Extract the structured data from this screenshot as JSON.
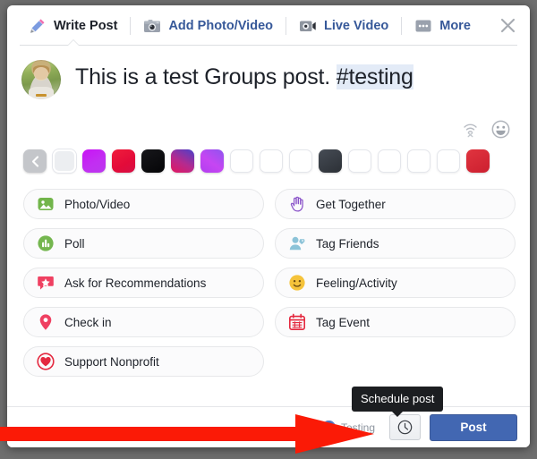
{
  "dialog": {
    "close_label": "close-icon"
  },
  "tabs": [
    {
      "label": "Write Post",
      "icon": "pencil-icon",
      "active": true
    },
    {
      "label": "Add Photo/Video",
      "icon": "camera-icon",
      "active": false
    },
    {
      "label": "Live Video",
      "icon": "video-camera-icon",
      "active": false
    },
    {
      "label": "More",
      "icon": "ellipsis-icon",
      "active": false
    }
  ],
  "composer": {
    "text_before": "This is a test Groups post. ",
    "hashtag": "#testing",
    "avatar_alt": "user-avatar"
  },
  "toolrow": [
    {
      "name": "gif-off-icon"
    },
    {
      "name": "emoji-icon"
    }
  ],
  "palette": {
    "prev_label": "chevron-left-icon",
    "swatches": [
      {
        "name": "swatch-white",
        "color": "#eceef1"
      },
      {
        "name": "swatch-magenta",
        "color": "#cf22f0"
      },
      {
        "name": "swatch-red",
        "color": "#e5173f"
      },
      {
        "name": "swatch-black",
        "color": "#0b0b0d"
      },
      {
        "name": "swatch-pink-blue",
        "color": "#c62368"
      },
      {
        "name": "swatch-purple",
        "color": "#b93df0"
      },
      {
        "name": "swatch-blank-1",
        "color": "#ffffff"
      },
      {
        "name": "swatch-blank-2",
        "color": "#ffffff"
      },
      {
        "name": "swatch-blank-3",
        "color": "#ffffff"
      },
      {
        "name": "swatch-dark-slate",
        "color": "#3a3f47"
      },
      {
        "name": "swatch-blank-4",
        "color": "#ffffff"
      },
      {
        "name": "swatch-blank-5",
        "color": "#ffffff"
      },
      {
        "name": "swatch-blank-6",
        "color": "#ffffff"
      },
      {
        "name": "swatch-blank-7",
        "color": "#ffffff"
      },
      {
        "name": "swatch-crimson",
        "color": "#d9293c"
      }
    ]
  },
  "options": [
    {
      "label": "Photo/Video",
      "icon": "photo-icon",
      "column": "left"
    },
    {
      "label": "Get Together",
      "icon": "wave-hand-icon",
      "column": "right"
    },
    {
      "label": "Poll",
      "icon": "poll-icon",
      "column": "left"
    },
    {
      "label": "Tag Friends",
      "icon": "tag-friends-icon",
      "column": "right"
    },
    {
      "label": "Ask for Recommendations",
      "icon": "recommend-icon",
      "column": "left"
    },
    {
      "label": "Feeling/Activity",
      "icon": "smiley-icon",
      "column": "right"
    },
    {
      "label": "Check in",
      "icon": "location-pin-icon",
      "column": "left"
    },
    {
      "label": "Tag Event",
      "icon": "calendar-icon",
      "column": "right"
    },
    {
      "label": "Support Nonprofit",
      "icon": "heart-icon",
      "column": "left"
    }
  ],
  "footer": {
    "audience_label": "Testing",
    "schedule_icon": "clock-icon",
    "post_label": "Post"
  },
  "tooltip": {
    "text": "Schedule post"
  },
  "annotation": {
    "arrow": "red-arrow-pointing-right"
  },
  "colors": {
    "brand_blue": "#4267b2",
    "link_blue": "#365899",
    "text_dark": "#1d2129",
    "tooltip_bg": "#1c1e21",
    "arrow_red": "#fb1a06",
    "hashtag_bg": "#e3ebf7"
  }
}
